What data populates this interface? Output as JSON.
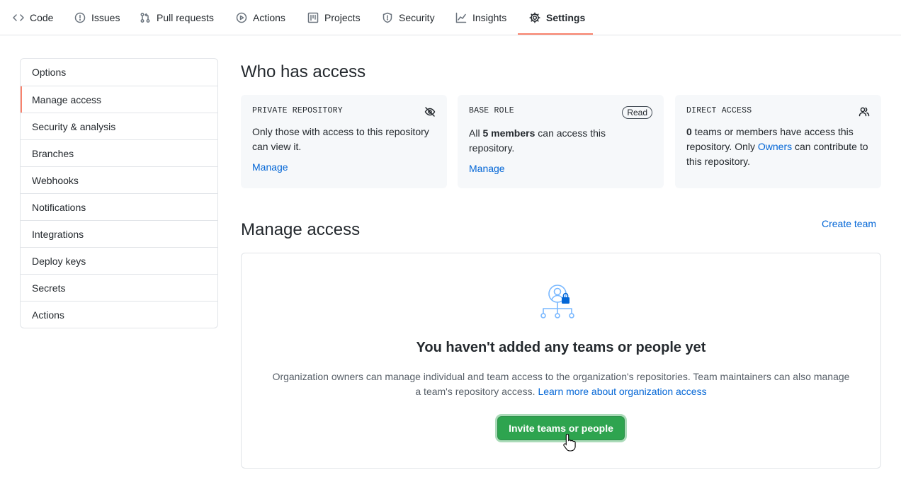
{
  "nav": {
    "tabs": [
      {
        "label": "Code",
        "icon": "code-icon"
      },
      {
        "label": "Issues",
        "icon": "issue-icon"
      },
      {
        "label": "Pull requests",
        "icon": "pull-request-icon"
      },
      {
        "label": "Actions",
        "icon": "play-icon"
      },
      {
        "label": "Projects",
        "icon": "project-icon"
      },
      {
        "label": "Security",
        "icon": "shield-icon"
      },
      {
        "label": "Insights",
        "icon": "graph-icon"
      },
      {
        "label": "Settings",
        "icon": "gear-icon",
        "selected": true
      }
    ]
  },
  "sidebar": {
    "items": [
      {
        "label": "Options"
      },
      {
        "label": "Manage access",
        "active": true
      },
      {
        "label": "Security & analysis"
      },
      {
        "label": "Branches"
      },
      {
        "label": "Webhooks"
      },
      {
        "label": "Notifications"
      },
      {
        "label": "Integrations"
      },
      {
        "label": "Deploy keys"
      },
      {
        "label": "Secrets"
      },
      {
        "label": "Actions"
      }
    ]
  },
  "who_has_access": {
    "title": "Who has access",
    "private_repo": {
      "heading": "PRIVATE REPOSITORY",
      "text": "Only those with access to this repository can view it.",
      "link": "Manage",
      "icon": "eye-closed-icon"
    },
    "base_role": {
      "heading": "BASE ROLE",
      "badge": "Read",
      "text_prefix": "All ",
      "text_bold": "5 members",
      "text_suffix": " can access this repository.",
      "link": "Manage"
    },
    "direct_access": {
      "heading": "DIRECT ACCESS",
      "count": "0",
      "text_middle": " teams or members have access this repository. Only ",
      "owners_link": "Owners",
      "text_end": " can contribute to this repository.",
      "icon": "people-icon"
    }
  },
  "manage_access": {
    "title": "Manage access",
    "create_team": "Create team",
    "empty_title": "You haven't added any teams or people yet",
    "empty_desc": "Organization owners can manage individual and team access to the organization's repositories. Team maintainers can also manage a team's repository access.",
    "learn_more": "Learn more about organization access",
    "invite_button": "Invite teams or people"
  },
  "colors": {
    "accent_underline": "#f9826c",
    "link": "#0366d6",
    "primary_button": "#2ea44f"
  }
}
